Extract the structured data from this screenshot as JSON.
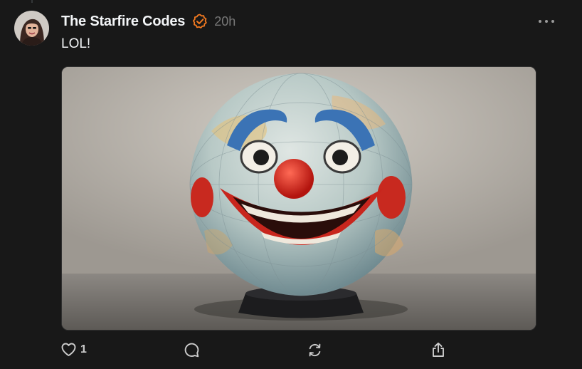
{
  "post": {
    "author": "The Starfire Codes",
    "timestamp": "20h",
    "text": "LOL!",
    "likes": "1"
  },
  "icons": {
    "verified": "verified-badge-icon",
    "more": "more-horizontal-icon",
    "like": "heart-icon",
    "reply": "comment-icon",
    "repost": "repost-icon",
    "share": "share-icon"
  },
  "colors": {
    "background": "#181818",
    "text": "#f3f5f7",
    "muted": "#777777",
    "verified_accent": "#f47a20"
  }
}
